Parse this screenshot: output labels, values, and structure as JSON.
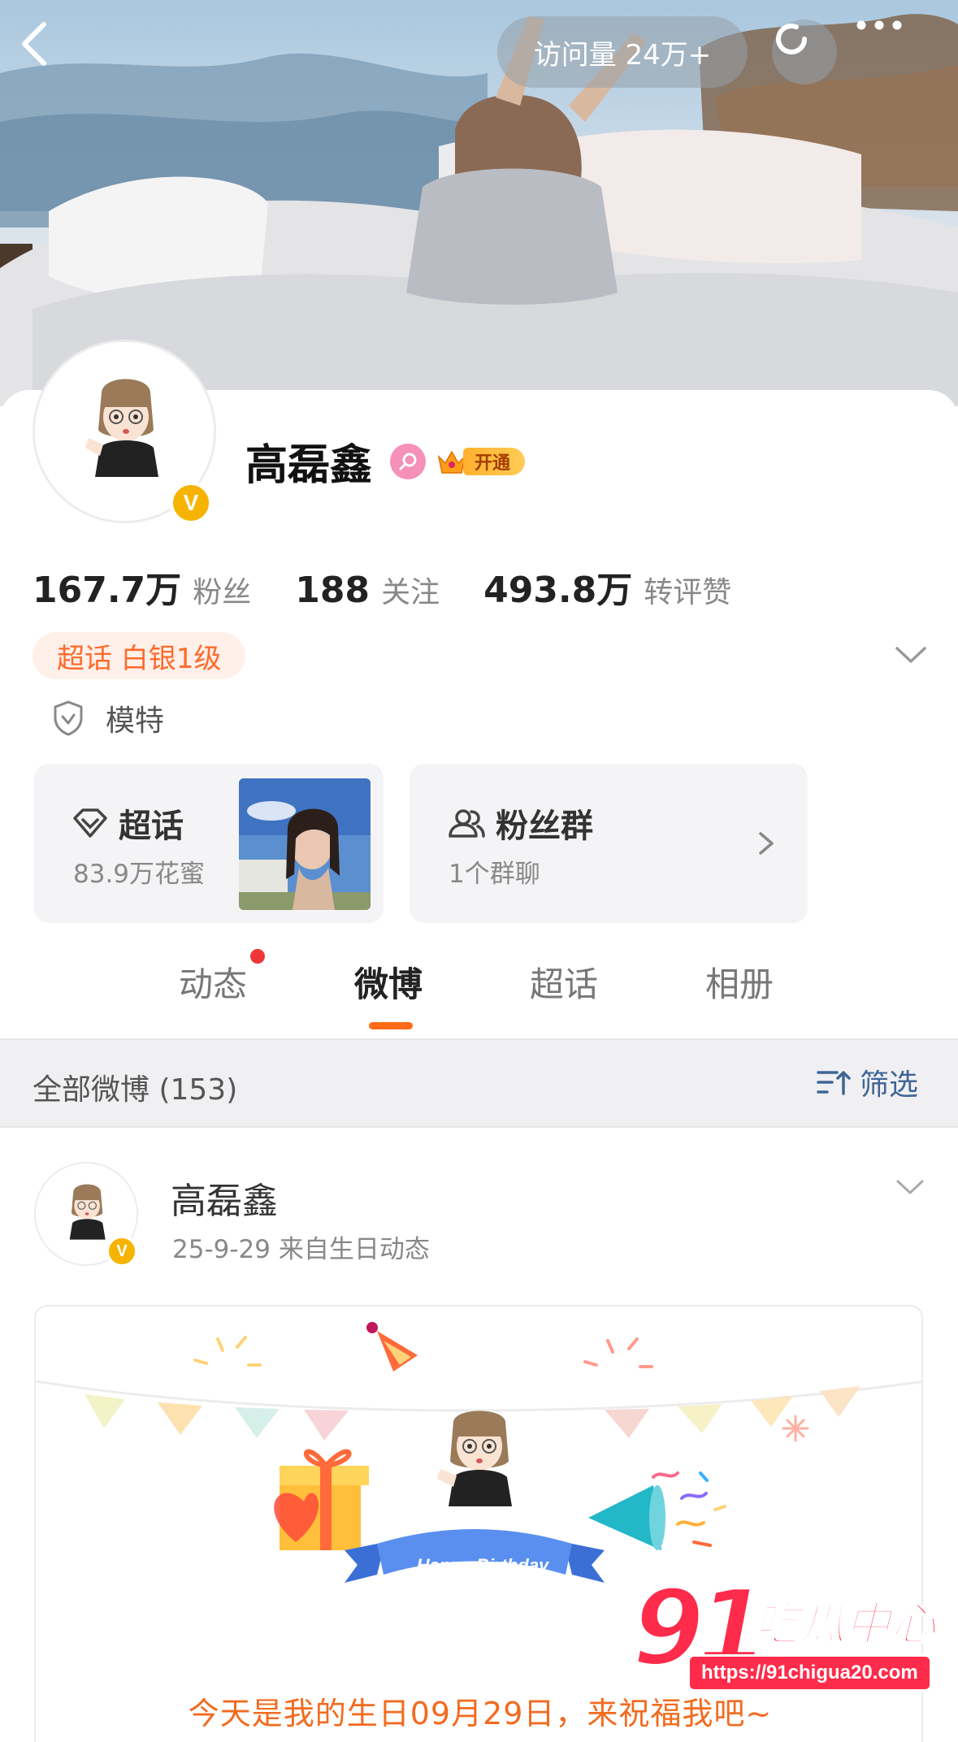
{
  "header": {
    "visits_label": "访问量 24万+"
  },
  "profile": {
    "name": "高磊鑫",
    "vip_label": "开通",
    "verified_mark": "V",
    "stats": [
      {
        "value": "167.7万",
        "label": "粉丝"
      },
      {
        "value": "188",
        "label": "关注"
      },
      {
        "value": "493.8万",
        "label": "转评赞"
      }
    ],
    "super_tag": "超话 白银1级",
    "occupation": "模特"
  },
  "cards": {
    "super_topic": {
      "title": "超话",
      "subtitle": "83.9万花蜜"
    },
    "fan_group": {
      "title": "粉丝群",
      "subtitle": "1个群聊"
    }
  },
  "tabs": [
    {
      "label": "动态",
      "has_dot": true
    },
    {
      "label": "微博",
      "active": true
    },
    {
      "label": "超话"
    },
    {
      "label": "相册"
    }
  ],
  "filter": {
    "count_label": "全部微博 (153)",
    "button_label": "筛选"
  },
  "post": {
    "author": "高磊鑫",
    "meta": "25-9-29  来自生日动态",
    "banner_text": "Happy Birthday",
    "message": "今天是我的生日09月29日，来祝福我吧~"
  },
  "watermark": {
    "number": "91",
    "name": "吃瓜中心",
    "url": "https://91chigua20.com"
  },
  "colors": {
    "accent": "#ff6b18",
    "link_blue": "#3f6596",
    "super_tag_text": "#ff6a2a",
    "vip_gold": "#ffb02e",
    "verified_yellow": "#f6b400"
  },
  "icons": [
    "back-arrow-icon",
    "refresh-icon",
    "more-dots-icon",
    "female-icon",
    "crown-icon",
    "chevron-down-icon",
    "shield-check-icon",
    "diamond-icon",
    "group-people-icon",
    "chevron-right-icon",
    "filter-sort-icon"
  ]
}
